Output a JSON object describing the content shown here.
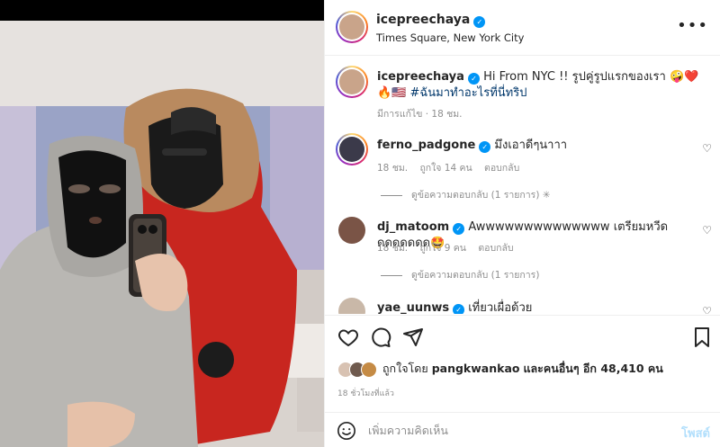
{
  "post": {
    "username": "icepreechaya",
    "location": "Times Square, New York City",
    "caption_text": "Hi From NYC !! รูปคู่รูปแรกของเรา 🤪❤️🔥🇺🇸",
    "caption_hashtag": "#ฉันมาทำอะไรที่นี่ทริป",
    "caption_meta": "มีการแก้ไข · 18 ชม."
  },
  "comments": [
    {
      "username": "ferno_padgone",
      "text": "มึงเอาดีๆนาาา",
      "time": "18 ชม.",
      "likes": "ถูกใจ 14 คน",
      "reply": "ตอบกลับ",
      "view_replies": "ดูข้อความตอบกลับ (1 รายการ)"
    },
    {
      "username": "dj_matoom",
      "text": "Awwwwwwwwwwwwww เตรียมหวีดดดดดดดด🤩",
      "time": "18 ชม.",
      "likes": "ถูกใจ 9 คน",
      "reply": "ตอบกลับ",
      "view_replies": "ดูข้อความตอบกลับ (1 รายการ)"
    },
    {
      "username": "yae_uunws",
      "text": "เที่ยวเผื่อด้วย"
    }
  ],
  "likes_summary": {
    "prefix": "ถูกใจโดย",
    "user": "pangkwankao",
    "suffix": "และคนอื่นๆ อีก 48,410 คน"
  },
  "timestamp": "18 ชั่วโมงที่แล้ว",
  "add_comment": {
    "placeholder": "เพิ่มความคิดเห็น",
    "post_label": "โพสต์"
  },
  "icons": [
    "heart-icon",
    "comment-icon",
    "share-icon",
    "bookmark-icon",
    "more-icon",
    "emoji-icon",
    "verified-icon"
  ],
  "colors": {
    "accent": "#0095f6",
    "post_button": "#b2dffc",
    "parka_red": "#c8261f"
  }
}
